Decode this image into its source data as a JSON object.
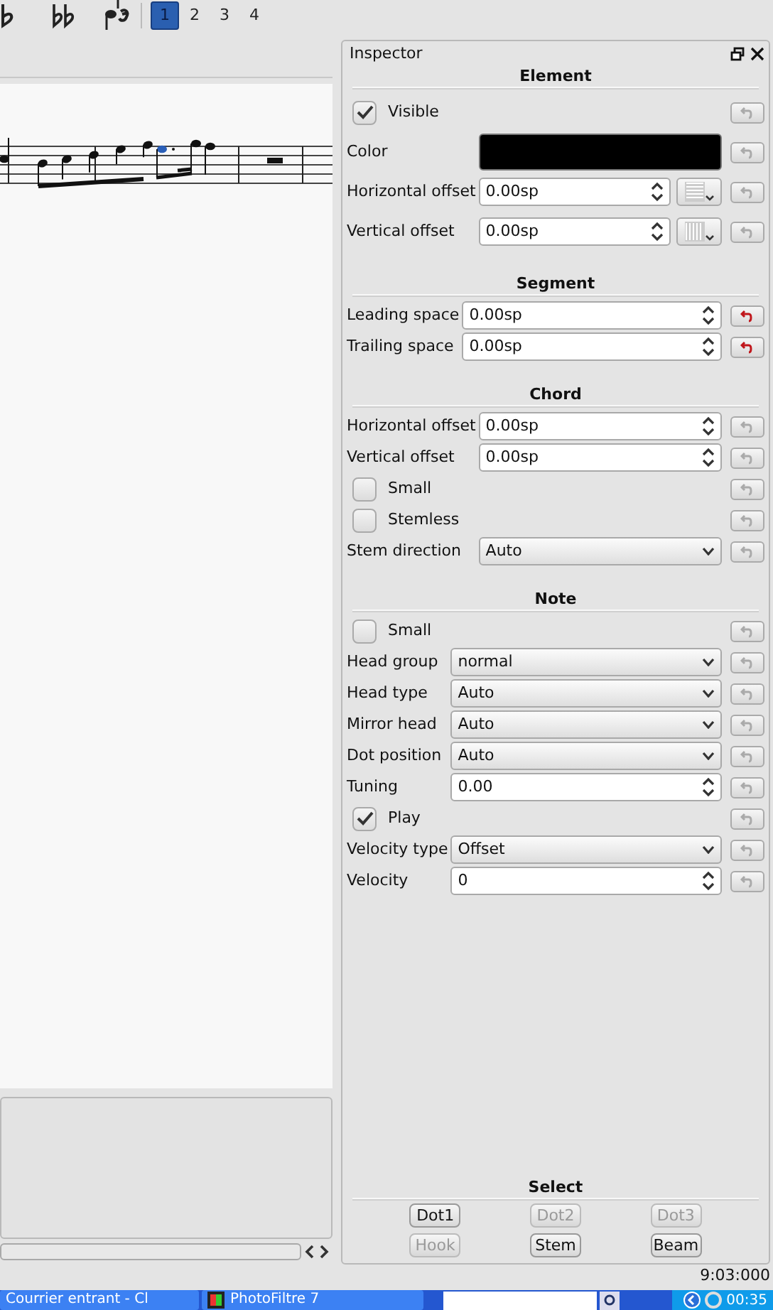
{
  "toolbar": {
    "voices": [
      {
        "label": "1",
        "selected": true
      },
      {
        "label": "2",
        "selected": false
      },
      {
        "label": "3",
        "selected": false
      },
      {
        "label": "4",
        "selected": false
      }
    ]
  },
  "inspector": {
    "title": "Inspector",
    "sections": [
      {
        "title": "Element",
        "rows": [
          {
            "kind": "checkbox",
            "label": "Visible",
            "checked": true,
            "modified": false
          },
          {
            "kind": "color",
            "label": "Color",
            "color": "#000000",
            "modified": false
          },
          {
            "kind": "spin",
            "label": "Horizontal offset",
            "value": "0.00sp",
            "has_menu": true,
            "menu_vertical": false,
            "modified": false
          },
          {
            "kind": "spin",
            "label": "Vertical offset",
            "value": "0.00sp",
            "has_menu": true,
            "menu_vertical": true,
            "modified": false
          }
        ]
      },
      {
        "title": "Segment",
        "rows": [
          {
            "kind": "spin",
            "label": "Leading space",
            "value": "0.00sp",
            "modified": true
          },
          {
            "kind": "spin",
            "label": "Trailing space",
            "value": "0.00sp",
            "modified": true
          }
        ]
      },
      {
        "title": "Chord",
        "rows": [
          {
            "kind": "spin",
            "label": "Horizontal offset",
            "value": "0.00sp",
            "modified": false
          },
          {
            "kind": "spin",
            "label": "Vertical offset",
            "value": "0.00sp",
            "modified": false
          },
          {
            "kind": "checkbox",
            "label": "Small",
            "checked": false,
            "modified": false
          },
          {
            "kind": "checkbox",
            "label": "Stemless",
            "checked": false,
            "modified": false
          },
          {
            "kind": "combo",
            "label": "Stem direction",
            "value": "Auto",
            "modified": false
          }
        ]
      },
      {
        "title": "Note",
        "rows": [
          {
            "kind": "checkbox",
            "label": "Small",
            "checked": false,
            "modified": false
          },
          {
            "kind": "combo",
            "label": "Head group",
            "value": "normal",
            "modified": false
          },
          {
            "kind": "combo",
            "label": "Head type",
            "value": "Auto",
            "modified": false
          },
          {
            "kind": "combo",
            "label": "Mirror head",
            "value": "Auto",
            "modified": false
          },
          {
            "kind": "combo",
            "label": "Dot position",
            "value": "Auto",
            "modified": false
          },
          {
            "kind": "spin",
            "label": "Tuning",
            "value": "0.00",
            "modified": false
          },
          {
            "kind": "checkbox",
            "label": "Play",
            "checked": true,
            "modified": false
          },
          {
            "kind": "combo",
            "label": "Velocity type",
            "value": "Offset",
            "modified": false
          },
          {
            "kind": "spin",
            "label": "Velocity",
            "value": "0",
            "modified": false
          }
        ]
      }
    ],
    "select": {
      "title": "Select",
      "buttons": [
        {
          "label": "Dot1",
          "disabled": false
        },
        {
          "label": "Dot2",
          "disabled": true
        },
        {
          "label": "Dot3",
          "disabled": true
        },
        {
          "label": "Hook",
          "disabled": true
        },
        {
          "label": "Stem",
          "disabled": false
        },
        {
          "label": "Beam",
          "disabled": false
        }
      ]
    }
  },
  "status_bar": {
    "time": "9:03:000"
  },
  "taskbar": {
    "items": [
      {
        "label": "Courrier entrant - Cl"
      },
      {
        "label": "PhotoFiltre 7"
      }
    ],
    "clock": "00:35"
  }
}
